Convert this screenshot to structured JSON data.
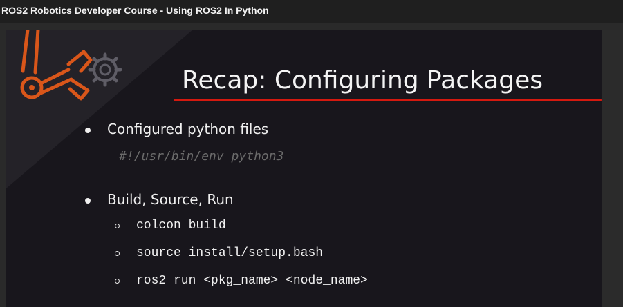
{
  "window": {
    "title": "ROS2 Robotics Developer Course - Using ROS2 In Python"
  },
  "slide": {
    "title": "Recap: Configuring Packages",
    "accent_color": "#d4190f",
    "logo_icon": "robot-arm-gear-icon",
    "bullets": [
      {
        "text": "Configured python files",
        "code": "#!/usr/bin/env python3"
      },
      {
        "text": "Build, Source, Run",
        "sub_items": [
          "colcon build",
          "source install/setup.bash",
          "ros2 run <pkg_name> <node_name>"
        ]
      }
    ]
  }
}
